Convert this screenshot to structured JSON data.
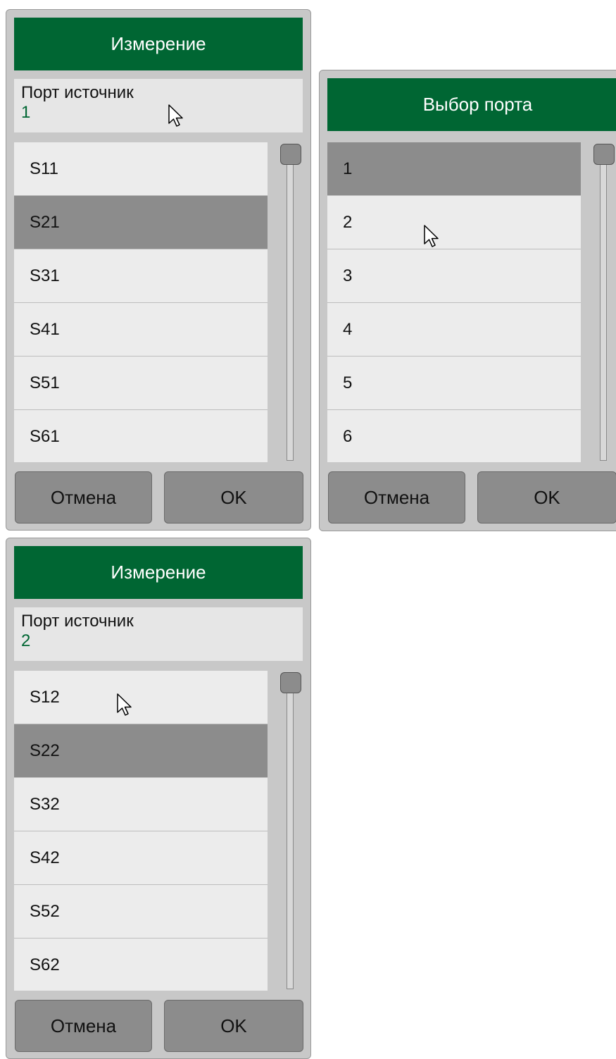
{
  "dialog_measure_1": {
    "title": "Измерение",
    "param_label": "Порт источник",
    "param_value": "1",
    "items": [
      "S11",
      "S21",
      "S31",
      "S41",
      "S51",
      "S61"
    ],
    "selected_index": 1,
    "cancel_label": "Отмена",
    "ok_label": "OK"
  },
  "dialog_port": {
    "title": "Выбор порта",
    "items": [
      "1",
      "2",
      "3",
      "4",
      "5",
      "6"
    ],
    "selected_index": 0,
    "cancel_label": "Отмена",
    "ok_label": "OK"
  },
  "dialog_measure_2": {
    "title": "Измерение",
    "param_label": "Порт источник",
    "param_value": "2",
    "items": [
      "S12",
      "S22",
      "S32",
      "S42",
      "S52",
      "S62"
    ],
    "selected_index": 1,
    "cancel_label": "Отмена",
    "ok_label": "OK"
  },
  "colors": {
    "title_bar": "#006633",
    "accent_text": "#006633",
    "selected_item": "#8c8c8c",
    "item_background": "#ececec"
  },
  "icons": [
    "mouse-pointer-icon"
  ]
}
